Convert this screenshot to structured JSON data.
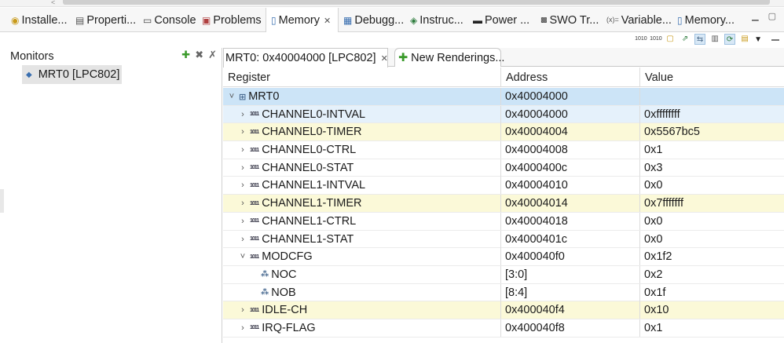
{
  "tabs": [
    {
      "label": "Installe...",
      "icon": "installed-icon"
    },
    {
      "label": "Properti...",
      "icon": "properties-icon"
    },
    {
      "label": "Console",
      "icon": "console-icon"
    },
    {
      "label": "Problems",
      "icon": "problems-icon"
    },
    {
      "label": "Memory",
      "icon": "memory-icon",
      "active": true
    },
    {
      "label": "Debugg...",
      "icon": "debugger-icon"
    },
    {
      "label": "Instruc...",
      "icon": "instruction-icon"
    },
    {
      "label": "Power ...",
      "icon": "power-icon"
    },
    {
      "label": "SWO Tr...",
      "icon": "swo-icon"
    },
    {
      "label": "Variable...",
      "icon": "variables-icon"
    },
    {
      "label": "Memory...",
      "icon": "memory-icon"
    }
  ],
  "monitors": {
    "title": "Monitors",
    "items": [
      "MRT0 [LPC802]"
    ]
  },
  "renderings": {
    "active_tab": "MRT0: 0x40004000 [LPC802]",
    "new_tab": "New Renderings..."
  },
  "table": {
    "headers": [
      "Register",
      "Address",
      "Value"
    ],
    "rows": [
      {
        "name": "MRT0",
        "address": "0x40004000",
        "value": "",
        "expand": "˅",
        "kind": "peripheral",
        "state": "selected",
        "indent": 0
      },
      {
        "name": "CHANNEL0-INTVAL",
        "address": "0x40004000",
        "value": "0xffffffff",
        "expand": "›",
        "kind": "register",
        "state": "lightblue",
        "indent": 1
      },
      {
        "name": "CHANNEL0-TIMER",
        "address": "0x40004004",
        "value": "0x5567bc5",
        "expand": "›",
        "kind": "register",
        "state": "changed",
        "indent": 1
      },
      {
        "name": "CHANNEL0-CTRL",
        "address": "0x40004008",
        "value": "0x1",
        "expand": "›",
        "kind": "register",
        "state": "",
        "indent": 1
      },
      {
        "name": "CHANNEL0-STAT",
        "address": "0x4000400c",
        "value": "0x3",
        "expand": "›",
        "kind": "register",
        "state": "",
        "indent": 1
      },
      {
        "name": "CHANNEL1-INTVAL",
        "address": "0x40004010",
        "value": "0x0",
        "expand": "›",
        "kind": "register",
        "state": "",
        "indent": 1
      },
      {
        "name": "CHANNEL1-TIMER",
        "address": "0x40004014",
        "value": "0x7fffffff",
        "expand": "›",
        "kind": "register",
        "state": "changed",
        "indent": 1
      },
      {
        "name": "CHANNEL1-CTRL",
        "address": "0x40004018",
        "value": "0x0",
        "expand": "›",
        "kind": "register",
        "state": "",
        "indent": 1
      },
      {
        "name": "CHANNEL1-STAT",
        "address": "0x4000401c",
        "value": "0x0",
        "expand": "›",
        "kind": "register",
        "state": "",
        "indent": 1
      },
      {
        "name": "MODCFG",
        "address": "0x400040f0",
        "value": "0x1f2",
        "expand": "˅",
        "kind": "register",
        "state": "",
        "indent": 1
      },
      {
        "name": "NOC",
        "address": "[3:0]",
        "value": "0x2",
        "expand": "",
        "kind": "field",
        "state": "",
        "indent": 2
      },
      {
        "name": "NOB",
        "address": "[8:4]",
        "value": "0x1f",
        "expand": "",
        "kind": "field",
        "state": "",
        "indent": 2
      },
      {
        "name": "IDLE-CH",
        "address": "0x400040f4",
        "value": "0x10",
        "expand": "›",
        "kind": "register",
        "state": "changed",
        "indent": 1
      },
      {
        "name": "IRQ-FLAG",
        "address": "0x400040f8",
        "value": "0x1",
        "expand": "›",
        "kind": "register",
        "state": "",
        "indent": 1
      }
    ]
  }
}
